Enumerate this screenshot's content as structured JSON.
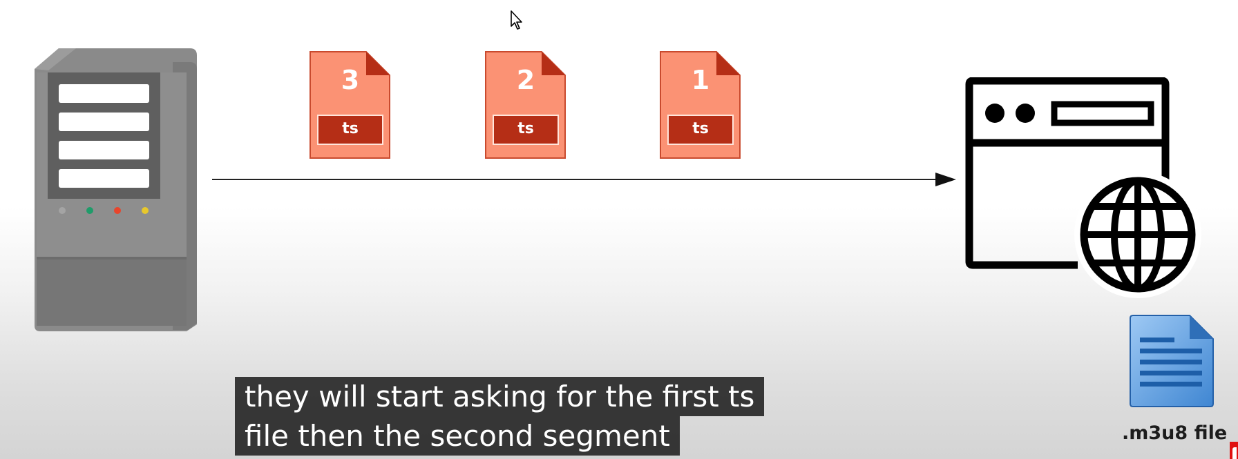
{
  "segments": [
    {
      "number": "3",
      "tag": "ts"
    },
    {
      "number": "2",
      "tag": "ts"
    },
    {
      "number": "1",
      "tag": "ts"
    }
  ],
  "playlist_file": {
    "label": ".m3u8 file"
  },
  "captions": {
    "line1": "they will start asking for the first ts",
    "line2": "file then the second segment"
  },
  "colors": {
    "ts_file_fill": "#fb9274",
    "ts_file_border": "#c94a2e",
    "ts_tag_fill": "#b52e16",
    "server_body": "#8f8f8f",
    "led_green": "#1f9c6a",
    "led_red": "#e8452c",
    "led_yellow": "#e8c82c",
    "browser_stroke": "#000000",
    "doc_blue": "#2f78c4",
    "caption_bg": "#080808"
  },
  "icons": [
    "server-icon",
    "ts-file-icon",
    "arrow-icon",
    "browser-globe-icon",
    "document-icon",
    "mouse-cursor-icon"
  ]
}
